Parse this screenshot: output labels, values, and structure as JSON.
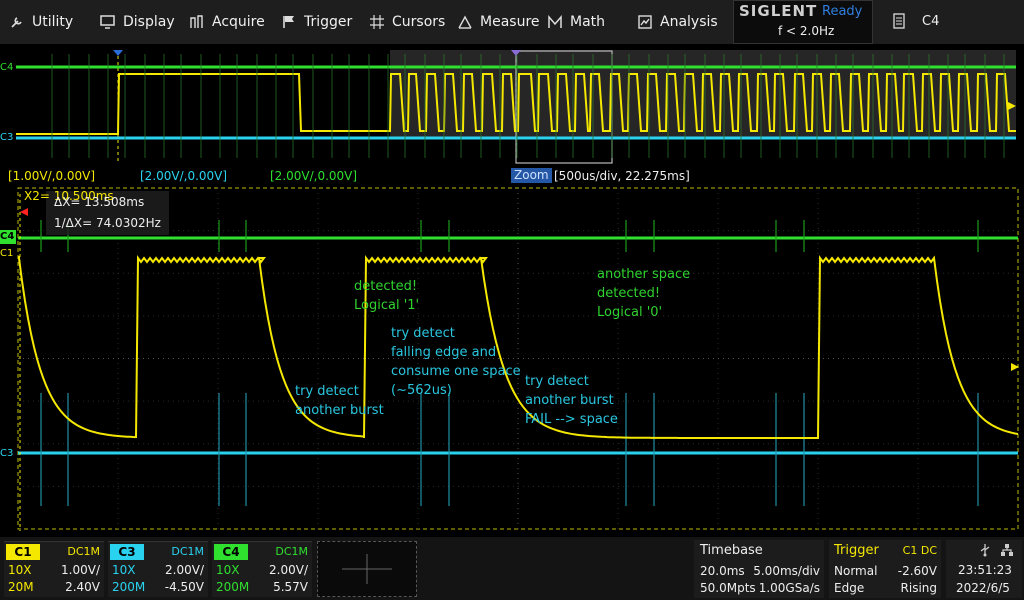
{
  "menu": [
    {
      "label": "Utility",
      "icon": "wrench-icon"
    },
    {
      "label": "Display",
      "icon": "monitor-icon"
    },
    {
      "label": "Acquire",
      "icon": "acquire-icon"
    },
    {
      "label": "Trigger",
      "icon": "flag-icon"
    },
    {
      "label": "Cursors",
      "icon": "crosshair-icon"
    },
    {
      "label": "Measure",
      "icon": "measure-icon"
    },
    {
      "label": "Math",
      "icon": "math-icon"
    },
    {
      "label": "Analysis",
      "icon": "analysis-icon"
    }
  ],
  "brand": "SIGLENT",
  "status": "Ready",
  "freq": "f < 2.0Hz",
  "trigger_source_top": "C4",
  "scales": {
    "c1": "[1.00V/,0.00V]",
    "c3": "[2.00V/,0.00V]",
    "c4": "[2.00V/,0.00V]"
  },
  "zoom": {
    "tag": "Zoom",
    "info": "[500us/div, 22.275ms]"
  },
  "cursor": {
    "x2": "X2= 10.500ms",
    "dx": "ΔX= 13.508ms",
    "inv": "1/ΔX= 74.0302Hz"
  },
  "channel_labels": {
    "c4": "C4",
    "c3": "C3",
    "c1": "C1"
  },
  "annotations": [
    {
      "id": "detected-1",
      "lines": [
        "detected!",
        "Logical '1'"
      ],
      "color": "#2fd32f"
    },
    {
      "id": "another-space",
      "lines": [
        "another space",
        "detected!",
        "Logical '0'"
      ],
      "color": "#2fd32f"
    },
    {
      "id": "try-falling",
      "lines": [
        "try detect",
        "falling edge and",
        "consume one space",
        "(~562us)"
      ],
      "color": "#29c7e0"
    },
    {
      "id": "try-burst-1",
      "lines": [
        "try detect",
        "another burst"
      ],
      "color": "#29c7e0"
    },
    {
      "id": "try-burst-2",
      "lines": [
        "try detect",
        "another burst",
        "FAIL --> space"
      ],
      "color": "#29c7e0"
    }
  ],
  "channels": [
    {
      "name": "C1",
      "coupling": "DC1M",
      "probe": "10X",
      "scale": "1.00V/",
      "bw": "20M",
      "offset": "2.40V",
      "color": "#f5e800"
    },
    {
      "name": "C3",
      "coupling": "DC1M",
      "probe": "10X",
      "scale": "2.00V/",
      "bw": "200M",
      "offset": "-4.50V",
      "color": "#29d3f0"
    },
    {
      "name": "C4",
      "coupling": "DC1M",
      "probe": "10X",
      "scale": "2.00V/",
      "bw": "200M",
      "offset": "5.57V",
      "color": "#2fe02f"
    }
  ],
  "timebase": {
    "title": "Timebase",
    "delay": "20.0ms",
    "div": "5.00ms/div",
    "mpts": "50.0Mpts",
    "rate": "1.00GSa/s"
  },
  "trigger": {
    "title": "Trigger",
    "src": "C1 DC",
    "mode": "Normal",
    "level": "-2.60V",
    "type": "Edge",
    "slope": "Rising"
  },
  "clock": {
    "time": "23:51:23",
    "date": "2022/6/5"
  },
  "colors": {
    "c1": "#f5e800",
    "c3": "#29d3f0",
    "c4": "#2fe02f",
    "accent": "#2458a6"
  }
}
